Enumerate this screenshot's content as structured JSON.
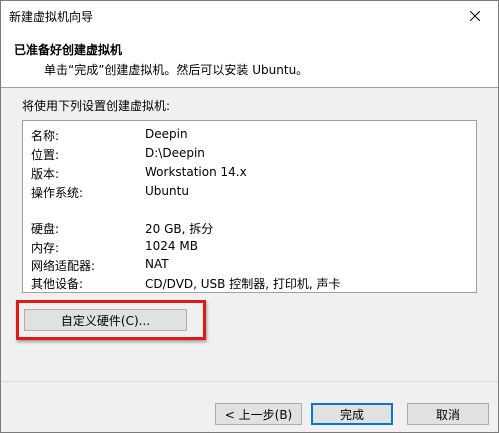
{
  "window": {
    "title": "新建虚拟机向导"
  },
  "header": {
    "title": "已准备好创建虚拟机",
    "subtitle": "单击“完成”创建虚拟机。然后可以安装 Ubuntu。"
  },
  "intro": "将使用下列设置创建虚拟机:",
  "summary": {
    "rows": [
      {
        "key": "名称:",
        "value": "Deepin"
      },
      {
        "key": "位置:",
        "value": "D:\\Deepin"
      },
      {
        "key": "版本:",
        "value": "Workstation 14.x"
      },
      {
        "key": "操作系统:",
        "value": "Ubuntu"
      },
      {
        "key": "硬盘:",
        "value": "20 GB, 拆分"
      },
      {
        "key": "内存:",
        "value": "1024 MB"
      },
      {
        "key": "网络适配器:",
        "value": "NAT"
      },
      {
        "key": "其他设备:",
        "value": "CD/DVD, USB 控制器, 打印机, 声卡"
      }
    ]
  },
  "buttons": {
    "customize_hardware": "自定义硬件(C)...",
    "back": "< 上一步(B)",
    "finish": "完成",
    "cancel": "取消"
  },
  "colors": {
    "highlight": "#e01818",
    "primary_border": "#0078d7"
  },
  "icons": {
    "close": "close-icon"
  }
}
